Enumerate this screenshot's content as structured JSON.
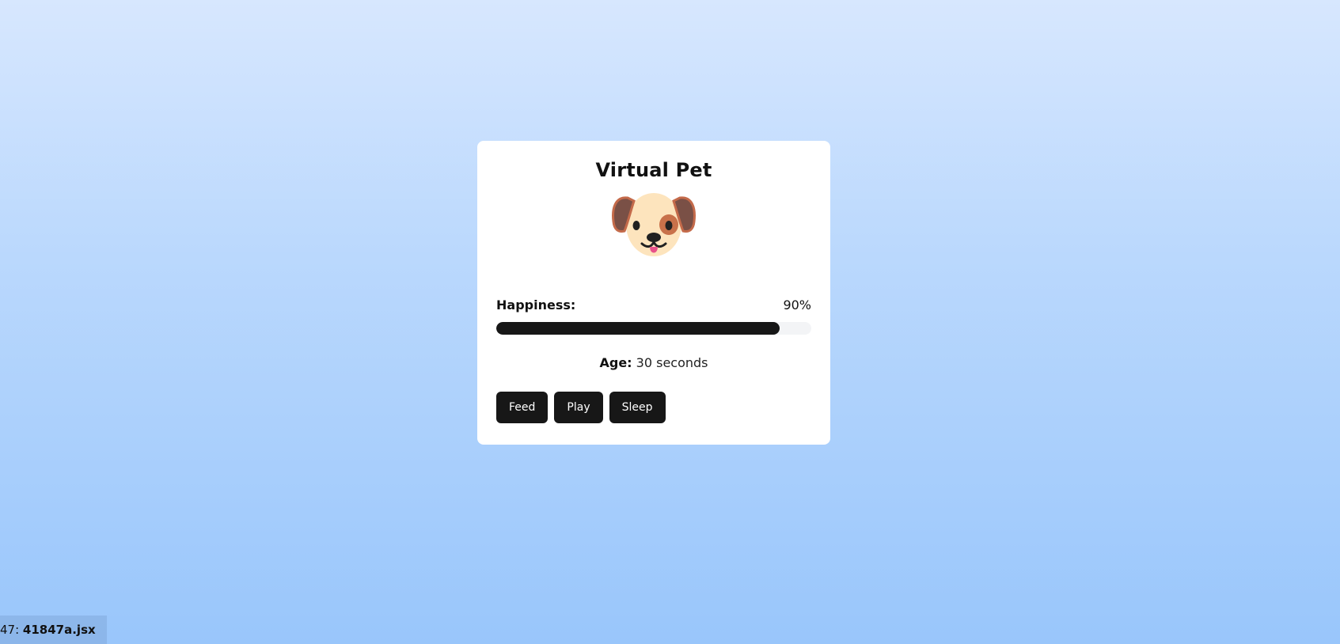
{
  "card": {
    "title": "Virtual Pet",
    "pet_icon": "dog-face-icon"
  },
  "stats": {
    "happiness_label": "Happiness:",
    "happiness_value_text": "90%",
    "happiness_fraction": 0.9,
    "age_label": "Age:",
    "age_value": "30 seconds"
  },
  "actions": {
    "feed": "Feed",
    "play": "Play",
    "sleep": "Sleep"
  },
  "file_tag": {
    "prefix": "47:",
    "name": "41847a.jsx"
  },
  "colors": {
    "accent": "#171717",
    "bar_track": "#f3f4f6",
    "background_top": "#d7e7fe",
    "background_bottom": "#99c6fb"
  }
}
